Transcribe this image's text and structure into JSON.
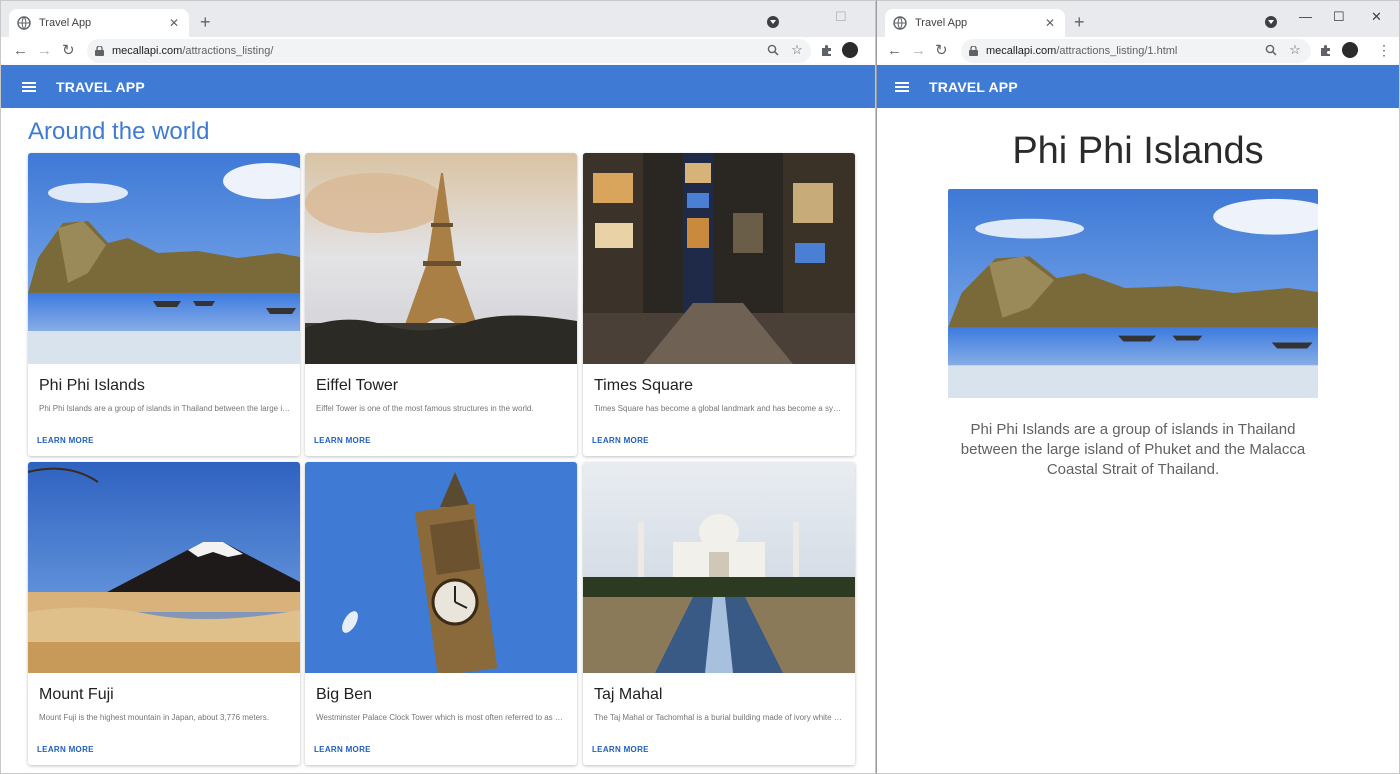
{
  "left_window": {
    "tab_title": "Travel App",
    "url_host": "mecallapi.com",
    "url_path": "/attractions_listing/",
    "app_title": "TRAVEL APP",
    "heading": "Around the world",
    "cards": [
      {
        "title": "Phi Phi Islands",
        "desc": "Phi Phi Islands are a group of islands in Thailand between the large island of Phuket and the Malacca Coastal Strait of Thailand.",
        "button": "LEARN MORE",
        "scene": "island-scene"
      },
      {
        "title": "Eiffel Tower",
        "desc": "Eiffel Tower is one of the most famous structures in the world.",
        "button": "LEARN MORE",
        "scene": "eiffel-scene"
      },
      {
        "title": "Times Square",
        "desc": "Times Square has become a global landmark and has become a symbol of New York City.",
        "button": "LEARN MORE",
        "scene": "times-square-scene"
      },
      {
        "title": "Mount Fuji",
        "desc": "Mount Fuji is the highest mountain in Japan, about 3,776 meters.",
        "button": "LEARN MORE",
        "scene": "fuji-scene"
      },
      {
        "title": "Big Ben",
        "desc": "Westminster Palace Clock Tower which is most often referred to as Big Ben.",
        "button": "LEARN MORE",
        "scene": "big-ben-scene"
      },
      {
        "title": "Taj Mahal",
        "desc": "The Taj Mahal or Tachomhal is a burial building made of ivory white marble.",
        "button": "LEARN MORE",
        "scene": "taj-mahal-scene"
      }
    ]
  },
  "right_window": {
    "tab_title": "Travel App",
    "url_host": "mecallapi.com",
    "url_path": "/attractions_listing/1.html",
    "app_title": "TRAVEL APP",
    "detail_title": "Phi Phi Islands",
    "detail_desc": "Phi Phi Islands are a group of islands in Thailand between the large island of Phuket and the Malacca Coastal Strait of Thailand.",
    "scene": "island-scene"
  },
  "colors": {
    "appbar": "#3f7bd4",
    "link": "#1f5fbf"
  }
}
